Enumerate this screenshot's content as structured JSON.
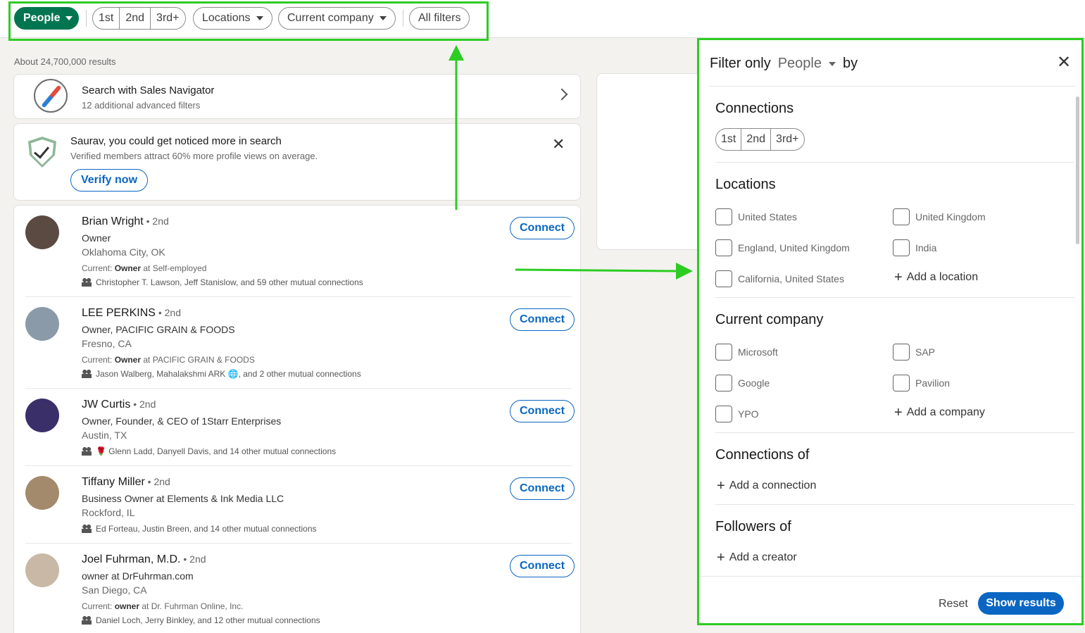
{
  "filter_bar": {
    "people_label": "People",
    "degrees": [
      "1st",
      "2nd",
      "3rd+"
    ],
    "locations_label": "Locations",
    "company_label": "Current company",
    "all_filters_label": "All filters"
  },
  "results": {
    "count_text": "About 24,700,000 results"
  },
  "sales_nav": {
    "title": "Search with Sales Navigator",
    "subtitle": "12 additional advanced filters"
  },
  "verify": {
    "title": "Saurav, you could get noticed more in search",
    "subtitle": "Verified members attract 60% more profile views on average.",
    "button_label": "Verify now"
  },
  "people": [
    {
      "name": "Brian Wright",
      "degree": " • 2nd",
      "title": "Owner",
      "location": "Oklahoma City, OK",
      "current_prefix": "Current: ",
      "current_role": "Owner",
      "current_suffix": " at Self-employed",
      "mutual": "Christopher T. Lawson, Jeff Stanislow, and 59 other mutual connections",
      "connect_label": "Connect"
    },
    {
      "name": "LEE PERKINS",
      "degree": " • 2nd",
      "title": "Owner, PACIFIC GRAIN & FOODS",
      "location": "Fresno, CA",
      "current_prefix": "Current: ",
      "current_role": "Owner",
      "current_suffix": " at PACIFIC GRAIN & FOODS",
      "mutual": "Jason Walberg, Mahalakshmi ARK 🌐, and 2 other mutual connections",
      "connect_label": "Connect"
    },
    {
      "name": "JW Curtis",
      "degree": " • 2nd",
      "title": "Owner, Founder, & CEO of 1Starr Enterprises",
      "location": "Austin, TX",
      "current_prefix": "",
      "current_role": "",
      "current_suffix": "",
      "mutual": "🌹 Glenn Ladd, Danyell Davis, and 14 other mutual connections",
      "connect_label": "Connect"
    },
    {
      "name": "Tiffany Miller",
      "degree": " • 2nd",
      "title": "Business Owner at Elements & Ink Media LLC",
      "location": "Rockford, IL",
      "current_prefix": "",
      "current_role": "",
      "current_suffix": "",
      "mutual": "Ed Forteau, Justin Breen, and 14 other mutual connections",
      "connect_label": "Connect"
    },
    {
      "name": "Joel Fuhrman, M.D.",
      "degree": " • 2nd",
      "title": "owner at DrFuhrman.com",
      "location": "San Diego, CA",
      "current_prefix": "Current: ",
      "current_role": "owner",
      "current_suffix": " at Dr. Fuhrman Online, Inc.",
      "mutual": "Daniel Loch, Jerry Binkley, and 12 other mutual connections",
      "connect_label": "Connect"
    }
  ],
  "panel": {
    "filter_only": "Filter only",
    "entity": "People",
    "by": "by",
    "close": "✕",
    "connections": {
      "title": "Connections",
      "options": [
        "1st",
        "2nd",
        "3rd+"
      ]
    },
    "locations": {
      "title": "Locations",
      "options": [
        "United States",
        "United Kingdom",
        "England, United Kingdom",
        "India",
        "California, United States"
      ],
      "add_label": "Add a location"
    },
    "company": {
      "title": "Current company",
      "options": [
        "Microsoft",
        "SAP",
        "Google",
        "Pavilion",
        "YPO"
      ],
      "add_label": "Add a company"
    },
    "connections_of": {
      "title": "Connections of",
      "add_label": "Add a connection"
    },
    "followers_of": {
      "title": "Followers of",
      "add_label": "Add a creator"
    },
    "reset_label": "Reset",
    "show_results_label": "Show results"
  },
  "colors": {
    "accent": "#0a66c2",
    "people_pill": "#01754f",
    "annotation": "#2dcc23"
  }
}
